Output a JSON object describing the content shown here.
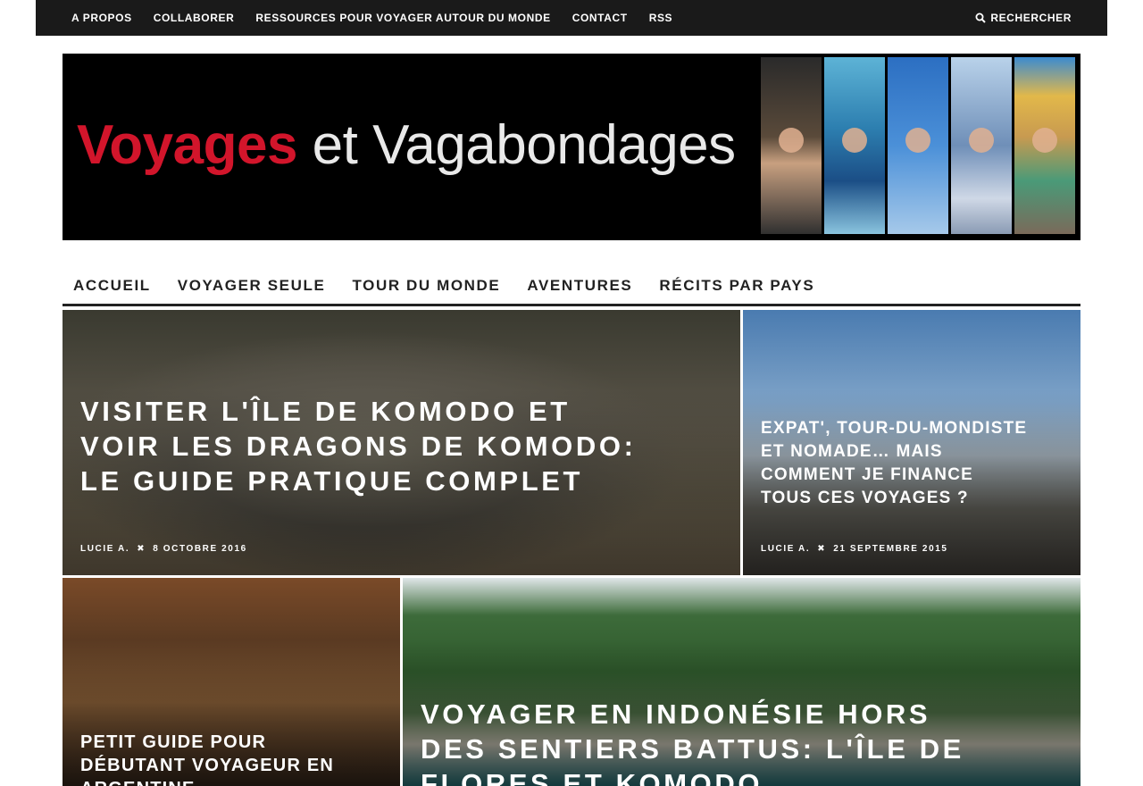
{
  "top_nav": {
    "items": [
      "A PROPOS",
      "COLLABORER",
      "RESSOURCES POUR VOYAGER AUTOUR DU MONDE",
      "CONTACT",
      "RSS"
    ],
    "search_label": "RECHERCHER"
  },
  "banner": {
    "logo_red": "Voyages",
    "logo_white": "et Vagabondages"
  },
  "main_nav": {
    "items": [
      "ACCUEIL",
      "VOYAGER SEULE",
      "TOUR DU MONDE",
      "AVENTURES",
      "RÉCITS PAR PAYS"
    ]
  },
  "posts": [
    {
      "title": "VISITER L'ÎLE DE KOMODO ET VOIR LES DRAGONS DE KOMODO: LE GUIDE PRATIQUE COMPLET",
      "author": "LUCIE A.",
      "date": "8 OCTOBRE 2016"
    },
    {
      "title": "EXPAT', TOUR-DU-MONDISTE ET NOMADE… MAIS COMMENT JE FINANCE TOUS CES VOYAGES ?",
      "author": "LUCIE A.",
      "date": "21 SEPTEMBRE 2015"
    },
    {
      "title": "PETIT GUIDE POUR DÉBUTANT VOYAGEUR EN ARGENTINE"
    },
    {
      "title": "VOYAGER EN INDONÉSIE HORS DES SENTIERS BATTUS: L'ÎLE DE FLORES ET KOMODO"
    }
  ],
  "meta_separator": "✖",
  "colors": {
    "topbar": "#1a1a1a",
    "logo_red": "#d2152b",
    "text_dark": "#222222"
  },
  "icons": {
    "search": "search-icon"
  }
}
